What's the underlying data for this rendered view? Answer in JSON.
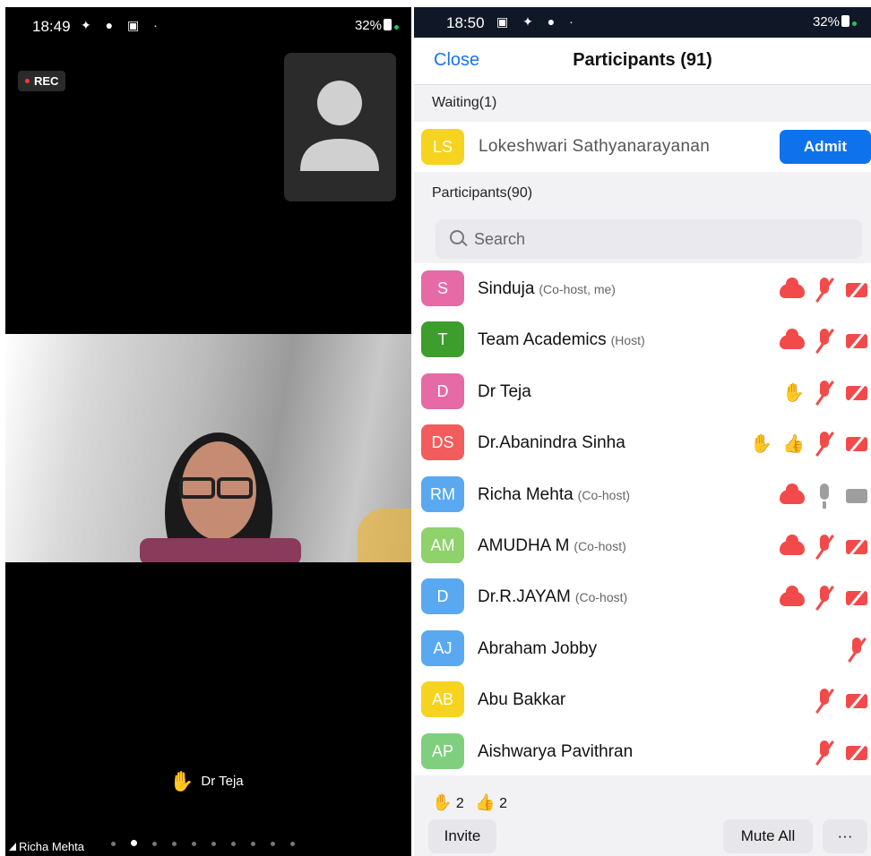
{
  "left": {
    "status_time": "18:49",
    "status_right": "32%",
    "rec_label": "REC",
    "reaction_hand": "✋",
    "reaction_name": "Dr Teja",
    "speaker_label": "Richa Mehta",
    "pager_count": 10,
    "pager_active_index": 1
  },
  "right": {
    "status_time": "18:50",
    "status_right": "32%",
    "close_label": "Close",
    "title": "Participants (91)",
    "waiting_header": "Waiting(1)",
    "waiting": {
      "initials": "LS",
      "name": "Lokeshwari Sathyanarayanan",
      "admit_label": "Admit",
      "avatar_color": "#f6d31e"
    },
    "participants_header": "Participants(90)",
    "search_placeholder": "Search",
    "participants": [
      {
        "initials": "S",
        "name": "Sinduja",
        "role": "(Co-host, me)",
        "color": "#e56aa6",
        "icons": [
          "cloud",
          "mic-muted",
          "cam-off"
        ]
      },
      {
        "initials": "T",
        "name": "Team Academics",
        "role": "(Host)",
        "color": "#3e9e2d",
        "icons": [
          "cloud",
          "mic-muted",
          "cam-off"
        ]
      },
      {
        "initials": "D",
        "name": "Dr  Teja",
        "role": "",
        "color": "#e56aa6",
        "icons": [
          "hand",
          "mic-muted",
          "cam-off"
        ]
      },
      {
        "initials": "DS",
        "name": "Dr.Abanindra Sinha",
        "role": "",
        "color": "#f25c5c",
        "icons": [
          "hand",
          "thumb",
          "mic-muted",
          "cam-off"
        ]
      },
      {
        "initials": "RM",
        "name": "Richa Mehta",
        "role": "(Co-host)",
        "color": "#5aa9f0",
        "icons": [
          "cloud",
          "mic-on",
          "cam-on"
        ]
      },
      {
        "initials": "AM",
        "name": "AMUDHA M",
        "role": "(Co-host)",
        "color": "#8fd16a",
        "icons": [
          "cloud",
          "mic-muted",
          "cam-off"
        ]
      },
      {
        "initials": "D",
        "name": "Dr.R.JAYAM",
        "role": "(Co-host)",
        "color": "#5aa9f0",
        "icons": [
          "cloud",
          "mic-muted",
          "cam-off"
        ]
      },
      {
        "initials": "AJ",
        "name": "Abraham Jobby",
        "role": "",
        "color": "#5aa9f0",
        "icons": [
          "mic-muted"
        ]
      },
      {
        "initials": "AB",
        "name": "Abu Bakkar",
        "role": "",
        "color": "#f6d31e",
        "icons": [
          "mic-muted",
          "cam-off"
        ]
      },
      {
        "initials": "AP",
        "name": "Aishwarya Pavithran",
        "role": "",
        "color": "#7fcf7f",
        "icons": [
          "mic-muted",
          "cam-off"
        ]
      }
    ],
    "reaction_counts": {
      "hand": "✋",
      "hand_count": "2",
      "thumb": "👍",
      "thumb_count": "2"
    },
    "invite_label": "Invite",
    "mute_all_label": "Mute All",
    "more_label": "···"
  }
}
